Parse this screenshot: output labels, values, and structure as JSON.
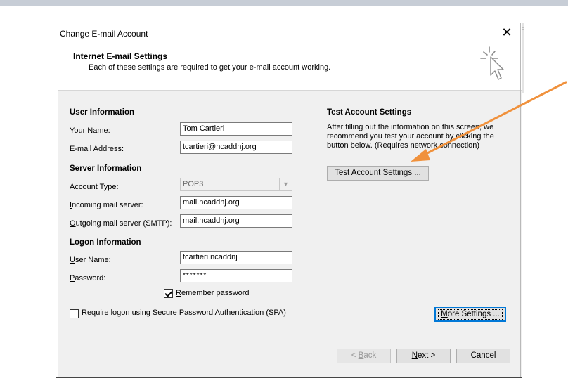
{
  "dialog": {
    "title": "Change E-mail Account",
    "header_title": "Internet E-mail Settings",
    "header_subtitle": "Each of these settings are required to get your e-mail account working."
  },
  "user_info": {
    "section": "User Information",
    "name_label_a": "Y",
    "name_label_b": "our Name:",
    "name_value": "Tom Cartieri",
    "email_label_a": "E",
    "email_label_b": "-mail Address:",
    "email_value": "tcartieri@ncaddnj.org"
  },
  "server_info": {
    "section": "Server Information",
    "account_type_label_a": "A",
    "account_type_label_b": "ccount Type:",
    "account_type_value": "POP3",
    "incoming_label_a": "I",
    "incoming_label_b": "ncoming mail server:",
    "incoming_value": "mail.ncaddnj.org",
    "outgoing_label_a": "O",
    "outgoing_label_b": "utgoing mail server (SMTP):",
    "outgoing_value": "mail.ncaddnj.org"
  },
  "logon_info": {
    "section": "Logon Information",
    "username_label_a": "U",
    "username_label_b": "ser Name:",
    "username_value": "tcartieri.ncaddnj",
    "password_label_a": "P",
    "password_label_b": "assword:",
    "password_value": "*******",
    "remember_label_a": "R",
    "remember_label_b": "emember password",
    "remember_checked": true,
    "spa_label_a": "Req",
    "spa_label_u": "u",
    "spa_label_b": "ire logon using Secure Password Authentication (SPA)",
    "spa_checked": false
  },
  "test_settings": {
    "section": "Test Account Settings",
    "description": "After filling out the information on this screen, we recommend you test your account by clicking the button below. (Requires network connection)",
    "button_a": "T",
    "button_b": "est Account Settings ..."
  },
  "buttons": {
    "more_settings_a": "M",
    "more_settings_b": "ore Settings ...",
    "back_a": "< ",
    "back_u": "B",
    "back_b": "ack",
    "next_a": "N",
    "next_b": "ext >",
    "cancel": "Cancel"
  },
  "icons": {
    "close": "close-icon",
    "wizard": "cursor-sparkle-icon"
  },
  "colors": {
    "annotation_arrow": "#f0913c",
    "default_button_border": "#0078d7",
    "panel_bg": "#f0f0f0"
  }
}
